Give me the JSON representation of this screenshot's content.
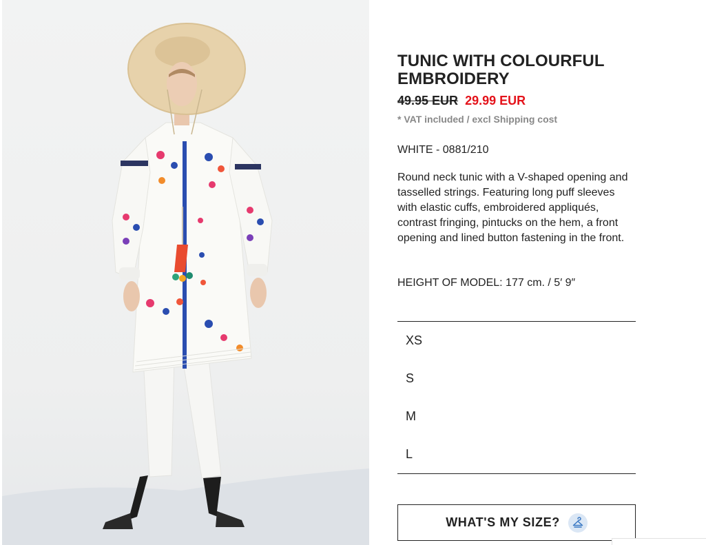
{
  "product": {
    "title_line1": "TUNIC WITH COLOURFUL",
    "title_line2": "EMBROIDERY",
    "old_price": "49.95 EUR",
    "new_price": "29.99 EUR",
    "vat_note": "* VAT included / excl Shipping cost",
    "color_ref": "WHITE - 0881/210",
    "description": "Round neck tunic with a V-shaped opening and tasselled strings. Featuring long puff sleeves with elastic cuffs, embroidered appliqués, contrast fringing, pintucks on the hem, a front opening and lined button fastening in the front.",
    "model_height": "HEIGHT OF MODEL: 177 cm. / 5′ 9″"
  },
  "sizes": [
    "XS",
    "S",
    "M",
    "L"
  ],
  "size_guide": {
    "label": "WHAT'S MY SIZE?",
    "icon": "hanger-icon"
  },
  "colors": {
    "sale_red": "#e4131b",
    "text": "#222222",
    "muted": "#888888",
    "icon_bg": "#dbe7f5",
    "icon_fg": "#3b79c4"
  }
}
